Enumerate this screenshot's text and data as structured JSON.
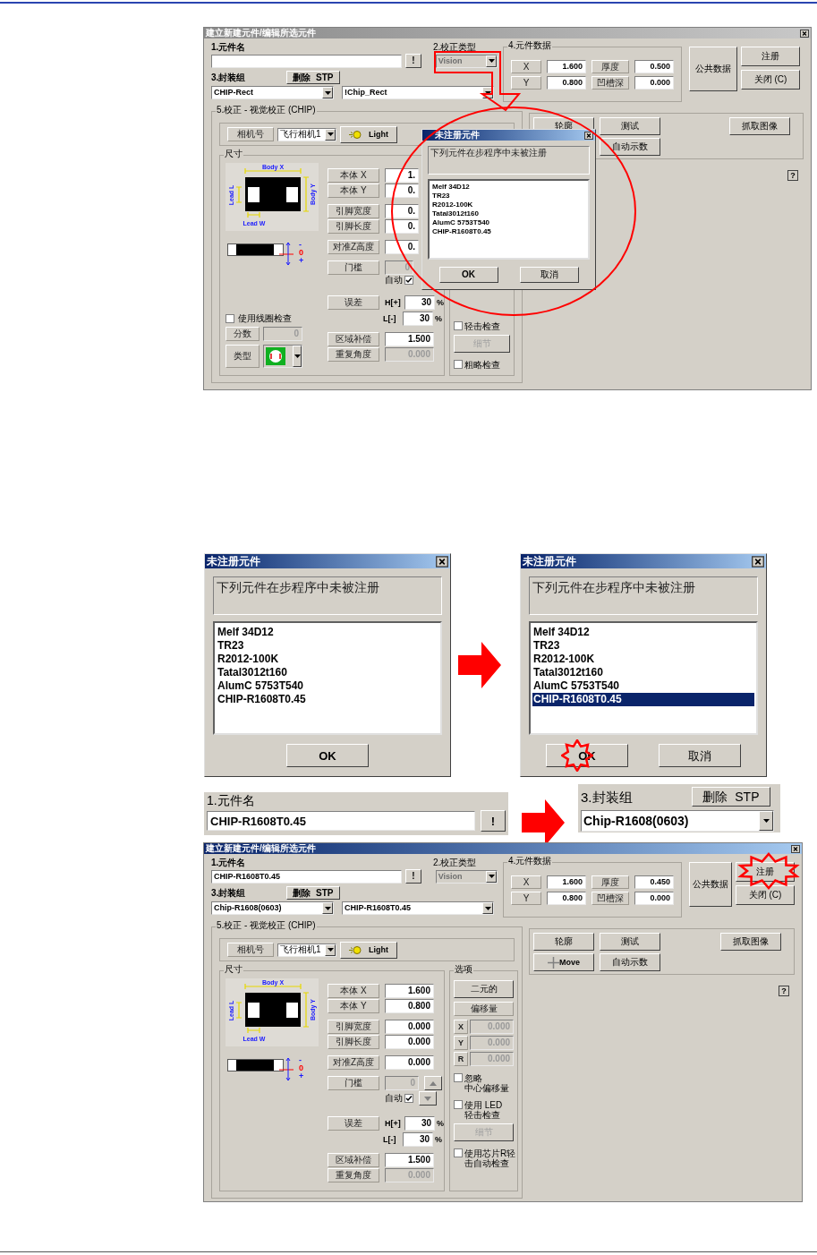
{
  "editor_before": {
    "title": "建立新建元件/编辑所选元件",
    "active": false,
    "part_name": {
      "label": "1.元件名",
      "button": "!"
    },
    "correction_type": {
      "label": "2.校正类型",
      "value": "Vision",
      "disabled": true
    },
    "package": {
      "label": "3.封装组",
      "delete_button": "删除  STP",
      "value": "CHIP-Rect",
      "variant": "!Chip_Rect"
    },
    "part_data": {
      "label": "4.元件数据",
      "fields": [
        {
          "label": "X",
          "value": "1.600"
        },
        {
          "label": "厚度",
          "value": "0.500"
        },
        {
          "label": "Y",
          "value": "0.800"
        },
        {
          "label": "凹槽深",
          "value": "0.000"
        }
      ]
    },
    "common_data_button": "公共数据",
    "register_button": "注册",
    "close_button": "关闭 (C)",
    "vision": {
      "label": "5.校正 - 视觉校正 (CHIP)",
      "camera_label": "相机号",
      "camera": "飞行相机1",
      "light_button": "Light",
      "size": {
        "label": "尺寸",
        "diagram": {
          "body_x": "Body X",
          "body_y": "Body Y",
          "lead_l": "Lead L",
          "lead_w": "Lead W"
        },
        "side_marks": [
          "-",
          "0",
          "+"
        ],
        "groups": [
          [
            {
              "kind": "field",
              "label": "本体 X",
              "value": "1."
            },
            {
              "kind": "field",
              "label": "本体 Y",
              "value": "0."
            }
          ],
          [
            {
              "kind": "field",
              "label": "引脚宽度",
              "value": "0."
            },
            {
              "kind": "field",
              "label": "引脚长度",
              "value": "0."
            }
          ],
          [
            {
              "kind": "field",
              "label": "对准Z高度",
              "value": "0."
            }
          ],
          [
            {
              "kind": "threshold",
              "label": "门槛",
              "value": "0",
              "disabled": true,
              "auto_label": "自动",
              "auto_checked": true
            }
          ],
          [
            {
              "kind": "tolerance",
              "label": "误差",
              "high_label": "H[+]",
              "high": "30",
              "high_unit": "%",
              "low_label": "L[-]",
              "low": "30",
              "low_unit": "%"
            }
          ],
          [
            {
              "kind": "field",
              "label": "区域补偿",
              "value": "1.500"
            },
            {
              "kind": "field",
              "label": "重复角度",
              "value": "0.000",
              "disabled": true
            }
          ]
        ],
        "coil": {
          "checkbox": "使用线圈检查",
          "checked": false,
          "score_label": "分数",
          "score": {
            "value": "0",
            "disabled": true
          },
          "type_label": "类型"
        }
      },
      "options": {
        "items": [
          {
            "kind": "checkbox",
            "lines": [
              "轻击检查"
            ],
            "checked": false
          },
          {
            "kind": "button",
            "text": "细节",
            "disabled": true
          },
          {
            "kind": "checkbox",
            "lines": [
              "粗略检查"
            ],
            "checked": false
          }
        ]
      }
    },
    "tools": {
      "rows": [
        [
          {
            "kind": "button",
            "text": "轮廓"
          },
          {
            "kind": "button",
            "text": "测试"
          }
        ],
        [
          "",
          {
            "kind": "button",
            "text": "自动示数"
          }
        ]
      ],
      "capture_button": "抓取图像",
      "help_button": "?"
    },
    "dialog": {
      "title": "未注册元件",
      "message": "下列元件在步程序中未被注册",
      "items": [
        {
          "text": "Melf 34D12",
          "selected": false
        },
        {
          "text": "TR23",
          "selected": false
        },
        {
          "text": "R2012-100K",
          "selected": false
        },
        {
          "text": "Tatal3012t160",
          "selected": false
        },
        {
          "text": "AlumC 5753T540",
          "selected": false
        },
        {
          "text": "CHIP-R1608T0.45",
          "selected": false
        }
      ],
      "buttons": [
        "OK",
        "取消"
      ]
    }
  },
  "dialog_steps": [
    {
      "title": "未注册元件",
      "message": "下列元件在步程序中未被注册",
      "items": [
        {
          "text": "Melf 34D12",
          "selected": false
        },
        {
          "text": "TR23",
          "selected": false
        },
        {
          "text": "R2012-100K",
          "selected": false
        },
        {
          "text": "Tatal3012t160",
          "selected": false
        },
        {
          "text": "AlumC 5753T540",
          "selected": false
        },
        {
          "text": "CHIP-R1608T0.45",
          "selected": false
        }
      ],
      "buttons": [
        "OK"
      ]
    },
    {
      "title": "未注册元件",
      "message": "下列元件在步程序中未被注册",
      "items": [
        {
          "text": "Melf 34D12",
          "selected": false
        },
        {
          "text": "TR23",
          "selected": false
        },
        {
          "text": "R2012-100K",
          "selected": false
        },
        {
          "text": "Tatal3012t160",
          "selected": false
        },
        {
          "text": "AlumC 5753T540",
          "selected": false
        },
        {
          "text": "CHIP-R1608T0.45",
          "selected": true
        }
      ],
      "buttons": [
        "OK",
        "取消"
      ]
    }
  ],
  "part_name_detail": {
    "label": "1.元件名",
    "value": "CHIP-R1608T0.45",
    "button": "!"
  },
  "package_detail": {
    "label": "3.封装组",
    "delete_button": "删除  STP",
    "value": "Chip-R1608(0603)"
  },
  "editor_after": {
    "title": "建立新建元件/编辑所选元件",
    "active": true,
    "part_name": {
      "label": "1.元件名",
      "value": "CHIP-R1608T0.45",
      "button": "!"
    },
    "correction_type": {
      "label": "2.校正类型",
      "value": "Vision",
      "disabled": true
    },
    "package": {
      "label": "3.封装组",
      "delete_button": "删除  STP",
      "value": "Chip-R1608(0603)",
      "variant": "CHIP-R1608T0.45"
    },
    "part_data": {
      "label": "4.元件数据",
      "fields": [
        {
          "label": "X",
          "value": "1.600"
        },
        {
          "label": "厚度",
          "value": "0.450"
        },
        {
          "label": "Y",
          "value": "0.800"
        },
        {
          "label": "凹槽深",
          "value": "0.000"
        }
      ]
    },
    "common_data_button": "公共数据",
    "register_button": "注册",
    "close_button": "关闭 (C)",
    "vision": {
      "label": "5.校正 - 视觉校正 (CHIP)",
      "camera_label": "相机号",
      "camera": "飞行相机1",
      "light_button": "Light",
      "size": {
        "label": "尺寸",
        "diagram": {
          "body_x": "Body X",
          "body_y": "Body Y",
          "lead_l": "Lead L",
          "lead_w": "Lead W"
        },
        "side_marks": [
          "-",
          "0",
          "+"
        ],
        "groups": [
          [
            {
              "kind": "field",
              "label": "本体 X",
              "value": "1.600"
            },
            {
              "kind": "field",
              "label": "本体 Y",
              "value": "0.800"
            }
          ],
          [
            {
              "kind": "field",
              "label": "引脚宽度",
              "value": "0.000"
            },
            {
              "kind": "field",
              "label": "引脚长度",
              "value": "0.000"
            }
          ],
          [
            {
              "kind": "field",
              "label": "对准Z高度",
              "value": "0.000"
            }
          ],
          [
            {
              "kind": "threshold",
              "label": "门槛",
              "value": "0",
              "disabled": true,
              "auto_label": "自动",
              "auto_checked": true
            }
          ],
          [
            {
              "kind": "tolerance",
              "label": "误差",
              "high_label": "H[+]",
              "high": "30",
              "high_unit": "%",
              "low_label": "L[-]",
              "low": "30",
              "low_unit": "%"
            }
          ],
          [
            {
              "kind": "field",
              "label": "区域补偿",
              "value": "1.500"
            },
            {
              "kind": "field",
              "label": "重复角度",
              "value": "0.000",
              "disabled": true
            }
          ]
        ]
      },
      "options": {
        "label": "选项",
        "items": [
          {
            "kind": "button",
            "text": "二元的",
            "disabled": false
          },
          {
            "kind": "label",
            "text": "偏移量"
          },
          {
            "kind": "offsets",
            "disabled": true,
            "fields": [
              {
                "label": "X",
                "value": "0.000"
              },
              {
                "label": "Y",
                "value": "0.000"
              },
              {
                "label": "R",
                "value": "0.000"
              }
            ]
          },
          {
            "kind": "checkbox",
            "lines": [
              "忽略",
              "中心偏移量"
            ],
            "checked": false
          },
          {
            "kind": "checkbox",
            "lines": [
              "使用 LED",
              "轻击检查"
            ],
            "checked": false
          },
          {
            "kind": "button",
            "text": "细节",
            "disabled": true
          },
          {
            "kind": "checkbox",
            "lines": [
              "使用芯片R轻",
              "击自动检查"
            ],
            "checked": false
          }
        ]
      }
    },
    "tools": {
      "rows": [
        [
          {
            "kind": "button",
            "text": "轮廓"
          },
          {
            "kind": "button",
            "text": "测试"
          }
        ],
        [
          {
            "kind": "move",
            "text": "Move"
          },
          {
            "kind": "button",
            "text": "自动示数"
          }
        ]
      ],
      "capture_button": "抓取图像",
      "help_button": "?"
    }
  }
}
